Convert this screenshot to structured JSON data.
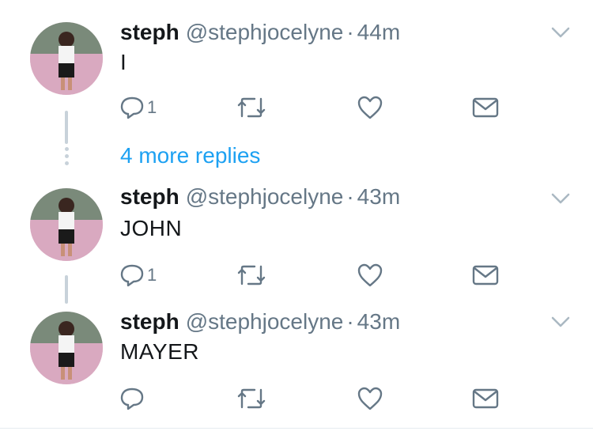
{
  "colors": {
    "accent": "#1da1f2",
    "secondary_text": "#657786",
    "thread_line": "#c8d2da"
  },
  "more_replies": "4 more replies",
  "tweets": [
    {
      "name": "steph",
      "handle": "@stephjocelyne",
      "separator": "·",
      "time": "44m",
      "text": "I",
      "reply_count": "1"
    },
    {
      "name": "steph",
      "handle": "@stephjocelyne",
      "separator": "·",
      "time": "43m",
      "text": "JOHN",
      "reply_count": "1"
    },
    {
      "name": "steph",
      "handle": "@stephjocelyne",
      "separator": "·",
      "time": "43m",
      "text": "MAYER",
      "reply_count": ""
    }
  ],
  "icons": [
    "reply-icon",
    "retweet-icon",
    "like-icon",
    "direct-message-icon",
    "chevron-down-icon"
  ]
}
